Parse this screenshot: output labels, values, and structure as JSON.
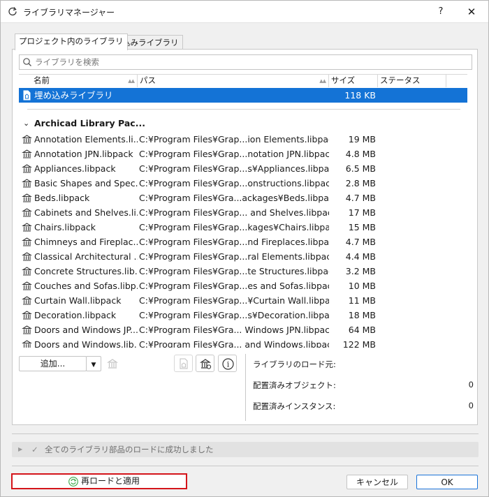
{
  "window": {
    "title": "ライブラリマネージャー",
    "help_label": "?",
    "close_label": "✕"
  },
  "tabs": [
    {
      "label": "プロジェクト内のライブラリ"
    },
    {
      "label": "埋め込みライブラリ"
    }
  ],
  "search": {
    "placeholder": "ライブラリを検索",
    "value": ""
  },
  "columns": {
    "name": "名前",
    "path": "パス",
    "size": "サイズ",
    "status": "ステータス"
  },
  "embedded_row": {
    "name": "埋め込みライブラリ",
    "size": "118 KB"
  },
  "group": {
    "label": "Archicad Library Pac..."
  },
  "libraries": [
    {
      "name": "Annotation Elements.li...",
      "path": "C:¥Program Files¥Grap...ion Elements.libpack",
      "size": "19 MB"
    },
    {
      "name": "Annotation JPN.libpack",
      "path": "C:¥Program Files¥Grap...notation JPN.libpack",
      "size": "4.8 MB"
    },
    {
      "name": "Appliances.libpack",
      "path": "C:¥Program Files¥Grap...s¥Appliances.libpack",
      "size": "6.5 MB"
    },
    {
      "name": "Basic Shapes and Spec...",
      "path": "C:¥Program Files¥Grap...onstructions.libpack",
      "size": "2.8 MB"
    },
    {
      "name": "Beds.libpack",
      "path": "C:¥Program Files¥Gra...ackages¥Beds.libpack",
      "size": "4.7 MB"
    },
    {
      "name": "Cabinets and Shelves.li...",
      "path": "C:¥Program Files¥Grap... and Shelves.libpack",
      "size": "17 MB"
    },
    {
      "name": "Chairs.libpack",
      "path": "C:¥Program Files¥Grap...kages¥Chairs.libpack",
      "size": "15 MB"
    },
    {
      "name": "Chimneys and Fireplac...",
      "path": "C:¥Program Files¥Grap...nd Fireplaces.libpack",
      "size": "4.7 MB"
    },
    {
      "name": "Classical Architectural ...",
      "path": "C:¥Program Files¥Grap...ral Elements.libpack",
      "size": "4.4 MB"
    },
    {
      "name": "Concrete Structures.lib...",
      "path": "C:¥Program Files¥Grap...te Structures.libpack",
      "size": "3.2 MB"
    },
    {
      "name": "Couches and Sofas.libp...",
      "path": "C:¥Program Files¥Grap...es and Sofas.libpack",
      "size": "10 MB"
    },
    {
      "name": "Curtain Wall.libpack",
      "path": "C:¥Program Files¥Grap...¥Curtain Wall.libpack",
      "size": "11 MB"
    },
    {
      "name": "Decoration.libpack",
      "path": "C:¥Program Files¥Grap...s¥Decoration.libpack",
      "size": "18 MB"
    },
    {
      "name": "Doors and Windows JP...",
      "path": "C:¥Program Files¥Gra... Windows JPN.libpack",
      "size": "64 MB"
    },
    {
      "name": "Doors and Windows.lib...",
      "path": "C:¥Program Files¥Gra... and Windows.libpack",
      "size": "122 MB"
    }
  ],
  "toolbar": {
    "add_label": "追加..."
  },
  "info": {
    "load_source_label": "ライブラリのロード元:",
    "placed_objects_label": "配置済みオブジェクト:",
    "placed_objects_value": "0",
    "placed_instances_label": "配置済みインスタンス:",
    "placed_instances_value": "0"
  },
  "status": {
    "text": "全てのライブラリ部品のロードに成功しました"
  },
  "footer": {
    "reload_label": "再ロードと適用",
    "cancel_label": "キャンセル",
    "ok_label": "OK"
  },
  "colors": {
    "selection": "#1473d6",
    "highlight_border": "#d4141a",
    "ok_border": "#1a73d9",
    "reload_icon": "#3aa848"
  }
}
